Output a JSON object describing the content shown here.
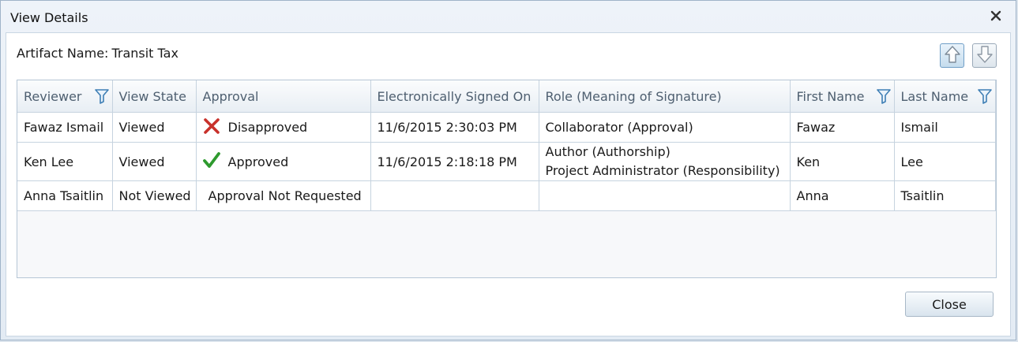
{
  "window": {
    "title": "View Details",
    "close_icon": "close-icon"
  },
  "artifact": {
    "label": "Artifact Name:",
    "value": "Transit Tax"
  },
  "nav": {
    "up_icon": "arrow-up-icon",
    "down_icon": "arrow-down-icon"
  },
  "table": {
    "headers": [
      "Reviewer",
      "View State",
      "Approval",
      "Electronically Signed On",
      "Role (Meaning of Signature)",
      "First Name",
      "Last Name"
    ],
    "filterable_columns": [
      "Reviewer",
      "First Name",
      "Last Name"
    ],
    "rows": [
      {
        "reviewer": "Fawaz Ismail",
        "view_state": "Viewed",
        "approval_icon": "cross-icon",
        "approval": "Disapproved",
        "signed_on": "11/6/2015 2:30:03 PM",
        "roles": [
          "Collaborator (Approval)"
        ],
        "first_name": "Fawaz",
        "last_name": "Ismail"
      },
      {
        "reviewer": "Ken Lee",
        "view_state": "Viewed",
        "approval_icon": "check-icon",
        "approval": "Approved",
        "signed_on": "11/6/2015 2:18:18 PM",
        "roles": [
          "Author (Authorship)",
          "Project Administrator (Responsibility)"
        ],
        "first_name": "Ken",
        "last_name": "Lee"
      },
      {
        "reviewer": "Anna Tsaitlin",
        "view_state": "Not Viewed",
        "approval_icon": "",
        "approval": "Approval Not Requested",
        "signed_on": "",
        "roles": [],
        "first_name": "Anna",
        "last_name": "Tsaitlin"
      }
    ]
  },
  "footer": {
    "close_label": "Close"
  },
  "colors": {
    "disapproved": "#c8312b",
    "approved": "#2e9a2e",
    "header_text": "#4e5f70"
  }
}
